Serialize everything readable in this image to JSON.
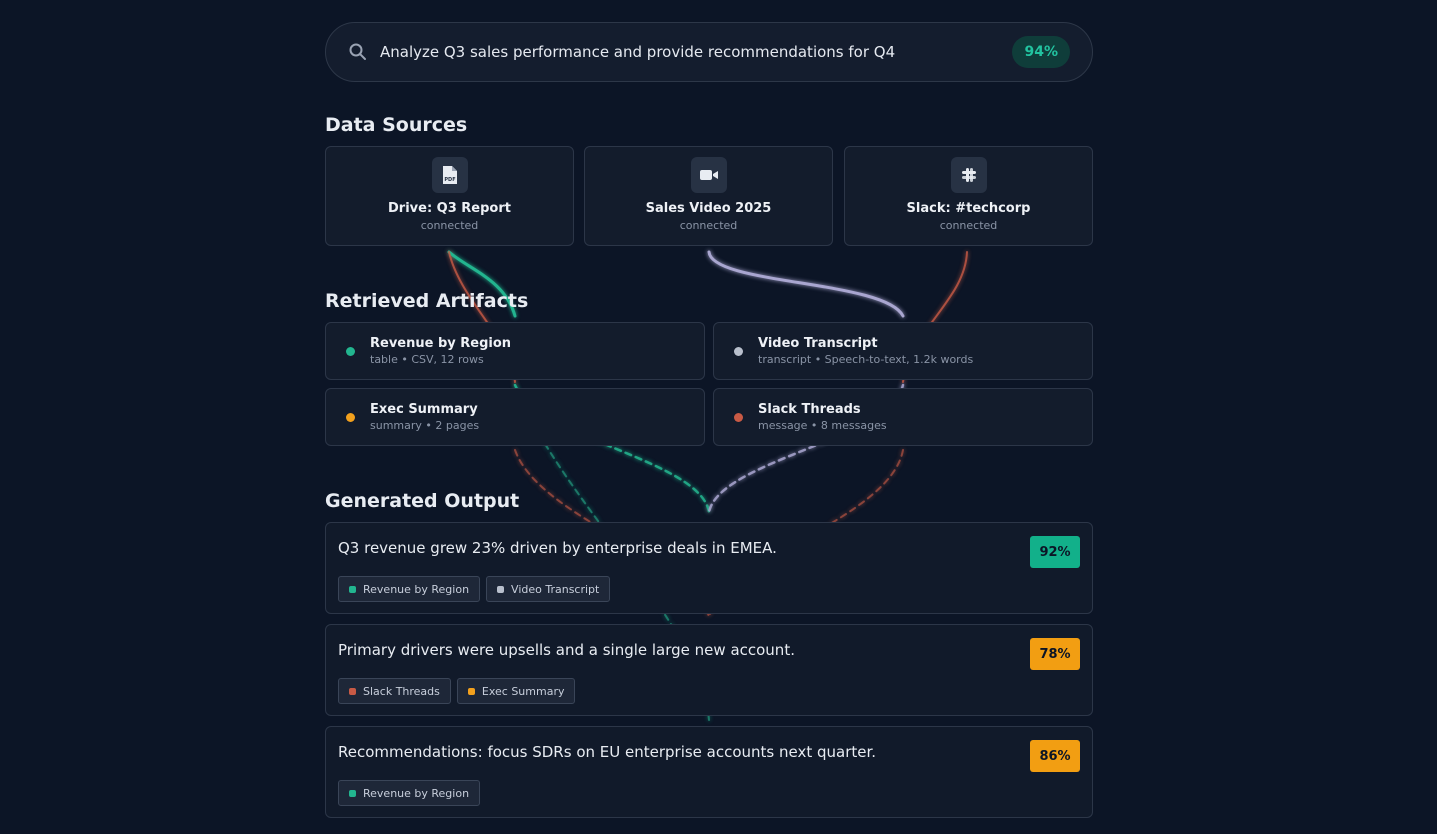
{
  "query": {
    "text": "Analyze Q3 sales performance and provide recommendations for Q4",
    "score": "94%",
    "icon": "search-icon"
  },
  "sections": {
    "sources": "Data Sources",
    "artifacts": "Retrieved Artifacts",
    "output": "Generated Output"
  },
  "sources": [
    {
      "name": "Drive: Q3 Report",
      "status": "connected",
      "icon": "pdf-file-icon"
    },
    {
      "name": "Sales Video 2025",
      "status": "connected",
      "icon": "video-camera-icon"
    },
    {
      "name": "Slack: #techcorp",
      "status": "connected",
      "icon": "slack-icon"
    }
  ],
  "artifacts": [
    {
      "name": "Revenue by Region",
      "meta": "table • CSV, 12 rows",
      "color": "#22b58f"
    },
    {
      "name": "Video Transcript",
      "meta": "transcript • Speech-to-text, 1.2k words",
      "color": "#b8bfcc"
    },
    {
      "name": "Exec Summary",
      "meta": "summary • 2 pages",
      "color": "#f2a01d"
    },
    {
      "name": "Slack Threads",
      "meta": "message • 8 messages",
      "color": "#c85a45"
    }
  ],
  "outputs": [
    {
      "text": "Q3 revenue grew 23% driven by enterprise deals in EMEA.",
      "confidence": "92%",
      "confidence_color": "#12b08a",
      "chips": [
        {
          "label": "Revenue by Region",
          "color": "#22b58f"
        },
        {
          "label": "Video Transcript",
          "color": "#b8bfcc"
        }
      ]
    },
    {
      "text": "Primary drivers were upsells and a single large new account.",
      "confidence": "78%",
      "confidence_color": "#f29e12",
      "chips": [
        {
          "label": "Slack Threads",
          "color": "#c85a45"
        },
        {
          "label": "Exec Summary",
          "color": "#f2a01d"
        }
      ]
    },
    {
      "text": "Recommendations: focus SDRs on EU enterprise accounts next quarter.",
      "confidence": "86%",
      "confidence_color": "#f29e12",
      "chips": [
        {
          "label": "Revenue by Region",
          "color": "#22b58f"
        }
      ]
    }
  ],
  "colors": {
    "teal": "#22b58f",
    "lavender": "#a9a6d0",
    "rust": "#c85a45"
  }
}
